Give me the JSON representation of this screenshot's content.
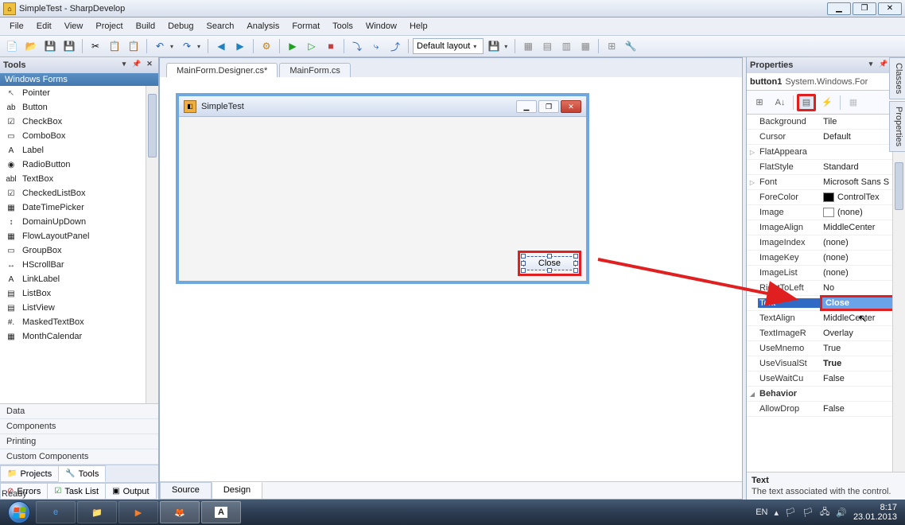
{
  "window": {
    "title": "SimpleTest - SharpDevelop"
  },
  "menu": [
    "File",
    "Edit",
    "View",
    "Project",
    "Build",
    "Debug",
    "Search",
    "Analysis",
    "Format",
    "Tools",
    "Window",
    "Help"
  ],
  "toolbar": {
    "layout_label": "Default layout"
  },
  "left": {
    "title": "Tools",
    "section": "Windows Forms",
    "items": [
      "Pointer",
      "Button",
      "CheckBox",
      "ComboBox",
      "Label",
      "RadioButton",
      "TextBox",
      "CheckedListBox",
      "DateTimePicker",
      "DomainUpDown",
      "FlowLayoutPanel",
      "GroupBox",
      "HScrollBar",
      "LinkLabel",
      "ListBox",
      "ListView",
      "MaskedTextBox",
      "MonthCalendar"
    ],
    "categories": [
      "Data",
      "Components",
      "Printing",
      "Custom Components"
    ],
    "bottom_tabs": {
      "projects": "Projects",
      "tools": "Tools"
    },
    "error_tabs": {
      "errors": "Errors",
      "tasklist": "Task List",
      "output": "Output"
    }
  },
  "center": {
    "tabs": {
      "active": "MainForm.Designer.cs*",
      "other": "MainForm.cs"
    },
    "form": {
      "title": "SimpleTest",
      "button_text": "Close"
    },
    "modes": {
      "source": "Source",
      "design": "Design"
    }
  },
  "right": {
    "title": "Properties",
    "object": {
      "name": "button1",
      "type": "System.Windows.For"
    },
    "rows": [
      {
        "k": "Background",
        "v": "Tile"
      },
      {
        "k": "Cursor",
        "v": "Default"
      },
      {
        "k": "FlatAppeara",
        "v": "",
        "ex": true
      },
      {
        "k": "FlatStyle",
        "v": "Standard"
      },
      {
        "k": "Font",
        "v": "Microsoft Sans S",
        "ex": true
      },
      {
        "k": "ForeColor",
        "v": "ControlTex",
        "sw": "#000000"
      },
      {
        "k": "Image",
        "v": "(none)",
        "sw": "#ffffff"
      },
      {
        "k": "ImageAlign",
        "v": "MiddleCenter"
      },
      {
        "k": "ImageIndex",
        "v": "(none)"
      },
      {
        "k": "ImageKey",
        "v": "(none)"
      },
      {
        "k": "ImageList",
        "v": "(none)"
      },
      {
        "k": "RightToLeft",
        "v": "No"
      },
      {
        "k": "Text",
        "v": "Close",
        "sel": true
      },
      {
        "k": "TextAlign",
        "v": "MiddleCenter"
      },
      {
        "k": "TextImageR",
        "v": "Overlay"
      },
      {
        "k": "UseMnemo",
        "v": "True"
      },
      {
        "k": "UseVisualSt",
        "v": "True",
        "bold": true
      },
      {
        "k": "UseWaitCu",
        "v": "False"
      }
    ],
    "category": {
      "k": "Behavior"
    },
    "after_cat": [
      {
        "k": "AllowDrop",
        "v": "False"
      }
    ],
    "help": {
      "name": "Text",
      "desc": "The text associated with the control."
    },
    "collapsed": [
      "Classes",
      "Properties"
    ]
  },
  "status": {
    "ready": "Ready"
  },
  "taskbar": {
    "lang": "EN",
    "time": "8:17",
    "date": "23.01.2013"
  }
}
